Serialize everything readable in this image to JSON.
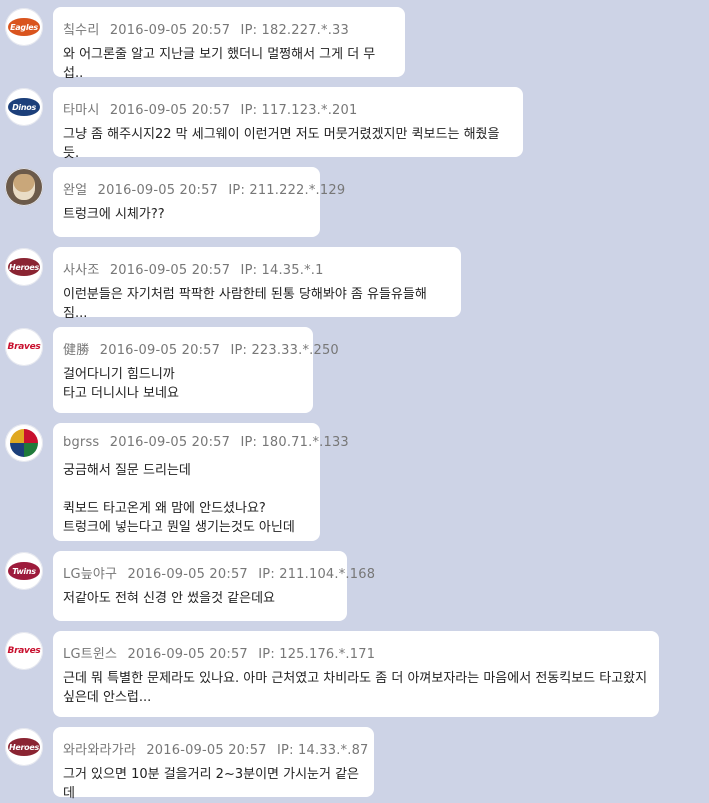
{
  "colors": {
    "background": "#cdd3e6",
    "bubble": "#ffffff",
    "meta_text": "#777777",
    "body_text": "#222222"
  },
  "comments": [
    {
      "nick": "칰수리",
      "date": "2016-09-05 20:57",
      "ip": "IP: 182.227.*.33",
      "text": "와 어그론줄 알고 지난글 보기 했더니 멀쩡해서 그게 더 무섭..",
      "avatar": "eagles-logo-icon"
    },
    {
      "nick": "타마시",
      "date": "2016-09-05 20:57",
      "ip": "IP: 117.123.*.201",
      "text": "그냥 좀 해주시지22 막 세그웨이 이런거면 저도 머뭇거렸겠지만 퀵보드는 해줬을듯.",
      "avatar": "dinos-logo-icon"
    },
    {
      "nick": "완얼",
      "date": "2016-09-05 20:57",
      "ip": "IP: 211.222.*.129",
      "text": "트렁크에 시체가??",
      "avatar": "dog-photo-avatar"
    },
    {
      "nick": "사사조",
      "date": "2016-09-05 20:57",
      "ip": "IP: 14.35.*.1",
      "text": "이런분들은 자기처럼 팍팍한 사람한테 된통 당해봐야 좀 유들유들해짐...",
      "avatar": "heroes-logo-icon"
    },
    {
      "nick": "健勝",
      "date": "2016-09-05 20:57",
      "ip": "IP: 223.33.*.250",
      "text": "걸어다니기 힘드니까\n타고 더니시나 보네요",
      "avatar": "braves-logo-icon"
    },
    {
      "nick": "bgrss",
      "date": "2016-09-05 20:57",
      "ip": "IP: 180.71.*.133",
      "text": "궁금해서 질문 드리는데\n\n퀵보드 타고온게 왜 맘에 안드셨나요?\n트렁크에 넣는다고 뭔일 생기는것도 아닌데",
      "avatar": "wbc-logo-icon"
    },
    {
      "nick": "LG늪야구",
      "date": "2016-09-05 20:57",
      "ip": "IP: 211.104.*.168",
      "text": "저같아도 전혀 신경 안 썼을것 같은데요",
      "avatar": "twins-logo-icon"
    },
    {
      "nick": "LG트윈스",
      "date": "2016-09-05 20:57",
      "ip": "IP: 125.176.*.171",
      "text": "근데 뭐 특별한 문제라도 있나요. 아마 근처였고 차비라도 좀 더 아껴보자라는 마음에서 전동킥보드 타고왔지\n싶은데 안스럽...",
      "avatar": "braves-logo-icon"
    },
    {
      "nick": "와라와라가라",
      "date": "2016-09-05 20:57",
      "ip": "IP: 14.33.*.87",
      "text": "그거 있으면 10분 걸을거리 2~3분이면 가시눈거 같은데",
      "avatar": "heroes-logo-icon"
    }
  ]
}
